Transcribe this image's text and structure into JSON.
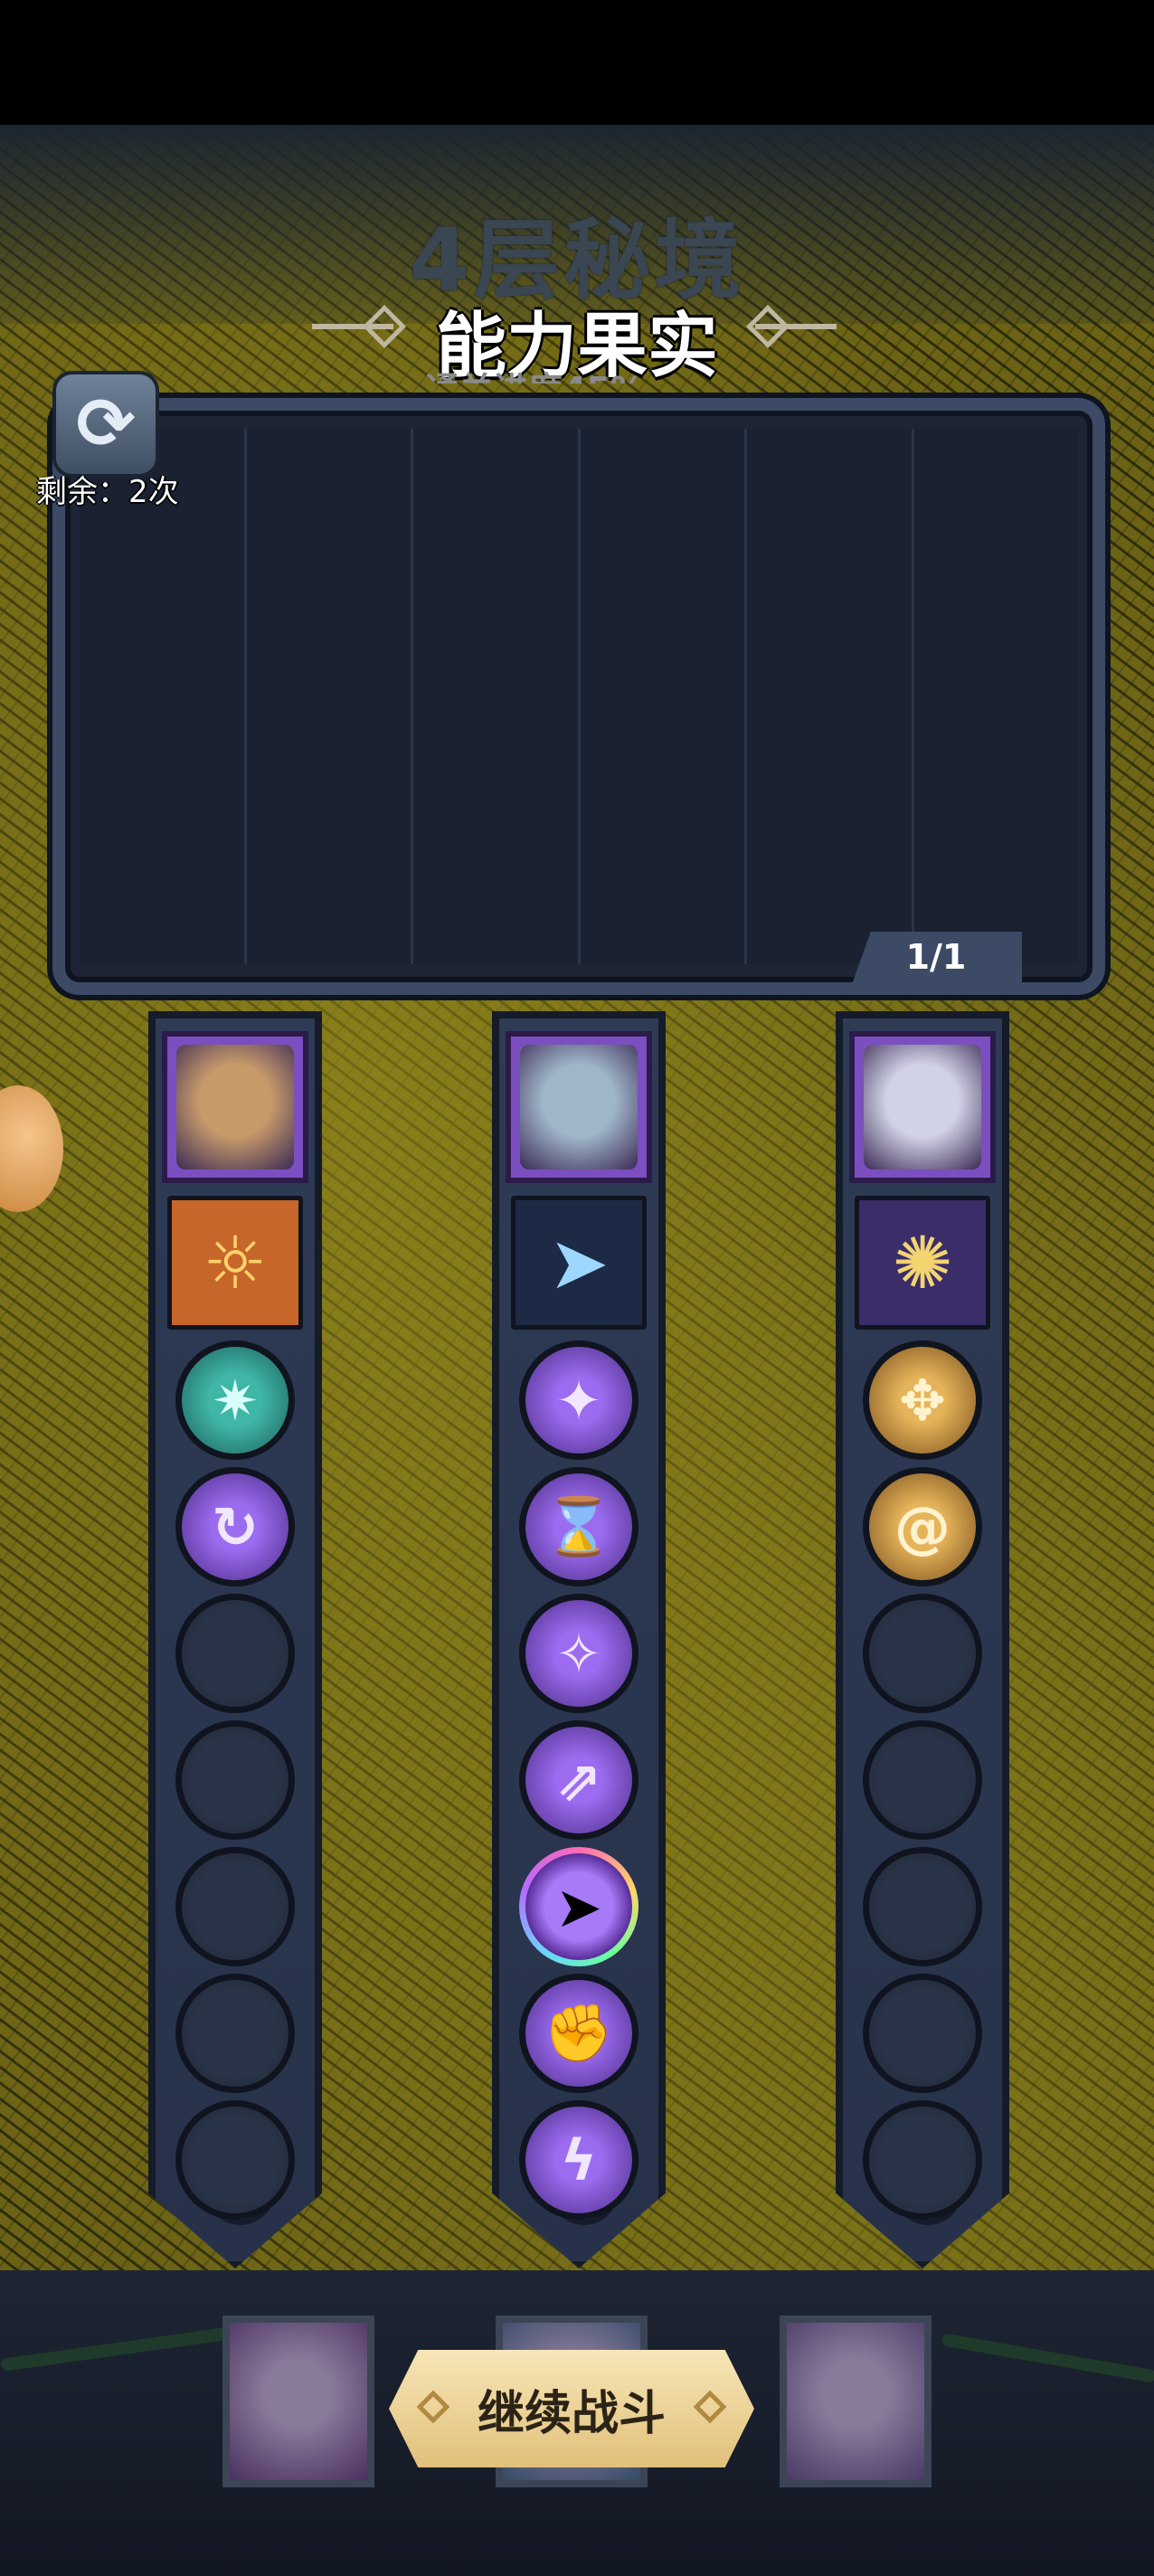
{
  "header": {
    "floor_title": "4层秘境",
    "panel_title": "能力果实",
    "progress_text": "通关进度45%"
  },
  "refresh": {
    "icon": "refresh-icon",
    "remaining_label": "剩余：2次"
  },
  "panel": {
    "page_counter": "1/1"
  },
  "heroes": [
    {
      "name_icon": "hero-portrait-golden-goddess",
      "portrait_color": "#7b4fbf",
      "face_color": "#c79a6a",
      "skill_card": {
        "icon": "sun-mask-card-icon",
        "glyph": "☼",
        "bg": "#c7662a",
        "fg": "#ffd36b"
      },
      "slots": [
        {
          "type": "teal",
          "icon": "crystal-burst-icon",
          "glyph": "✷"
        },
        {
          "type": "purple",
          "icon": "spiral-arrow-icon",
          "glyph": "↻"
        },
        {
          "type": "empty"
        },
        {
          "type": "empty"
        },
        {
          "type": "empty"
        },
        {
          "type": "empty"
        },
        {
          "type": "empty"
        }
      ]
    },
    {
      "name_icon": "hero-portrait-mech-robot",
      "portrait_color": "#7b4fbf",
      "face_color": "#9fb5c8",
      "skill_card": {
        "icon": "jet-dash-card-icon",
        "glyph": "➤",
        "bg": "#1c2a46",
        "fg": "#9ed7ff"
      },
      "slots": [
        {
          "type": "purple",
          "icon": "claw-strike-icon",
          "glyph": "✦"
        },
        {
          "type": "purple",
          "icon": "hourglass-icon",
          "glyph": "⌛"
        },
        {
          "type": "purple",
          "icon": "shard-split-icon",
          "glyph": "✧"
        },
        {
          "type": "purple",
          "icon": "rising-arrows-icon",
          "glyph": "⇗"
        },
        {
          "type": "rainbow",
          "icon": "arrow-strike-icon",
          "glyph": "➤"
        },
        {
          "type": "purple",
          "icon": "power-fist-icon",
          "glyph": "✊"
        },
        {
          "type": "purple",
          "icon": "lightning-dots-icon",
          "glyph": "ϟ"
        }
      ]
    },
    {
      "name_icon": "hero-portrait-silver-sorceress",
      "portrait_color": "#7b4fbf",
      "face_color": "#d2d2e6",
      "skill_card": {
        "icon": "golden-beam-card-icon",
        "glyph": "✺",
        "bg": "#3a2d6a",
        "fg": "#f3d470"
      },
      "slots": [
        {
          "type": "gold",
          "icon": "cross-arrows-icon",
          "glyph": "✥"
        },
        {
          "type": "gold",
          "icon": "swirl-scroll-icon",
          "glyph": "@"
        },
        {
          "type": "empty"
        },
        {
          "type": "empty"
        },
        {
          "type": "empty"
        },
        {
          "type": "empty"
        },
        {
          "type": "empty"
        }
      ]
    }
  ],
  "bottom": {
    "continue_label": "继续战斗",
    "portraits": [
      {
        "icon": "bottom-hero-portrait-1",
        "color": "#4a3160"
      },
      {
        "icon": "bottom-hero-portrait-2",
        "color": "#334a66"
      },
      {
        "icon": "bottom-hero-portrait-3",
        "color": "#4a3a66"
      }
    ]
  }
}
